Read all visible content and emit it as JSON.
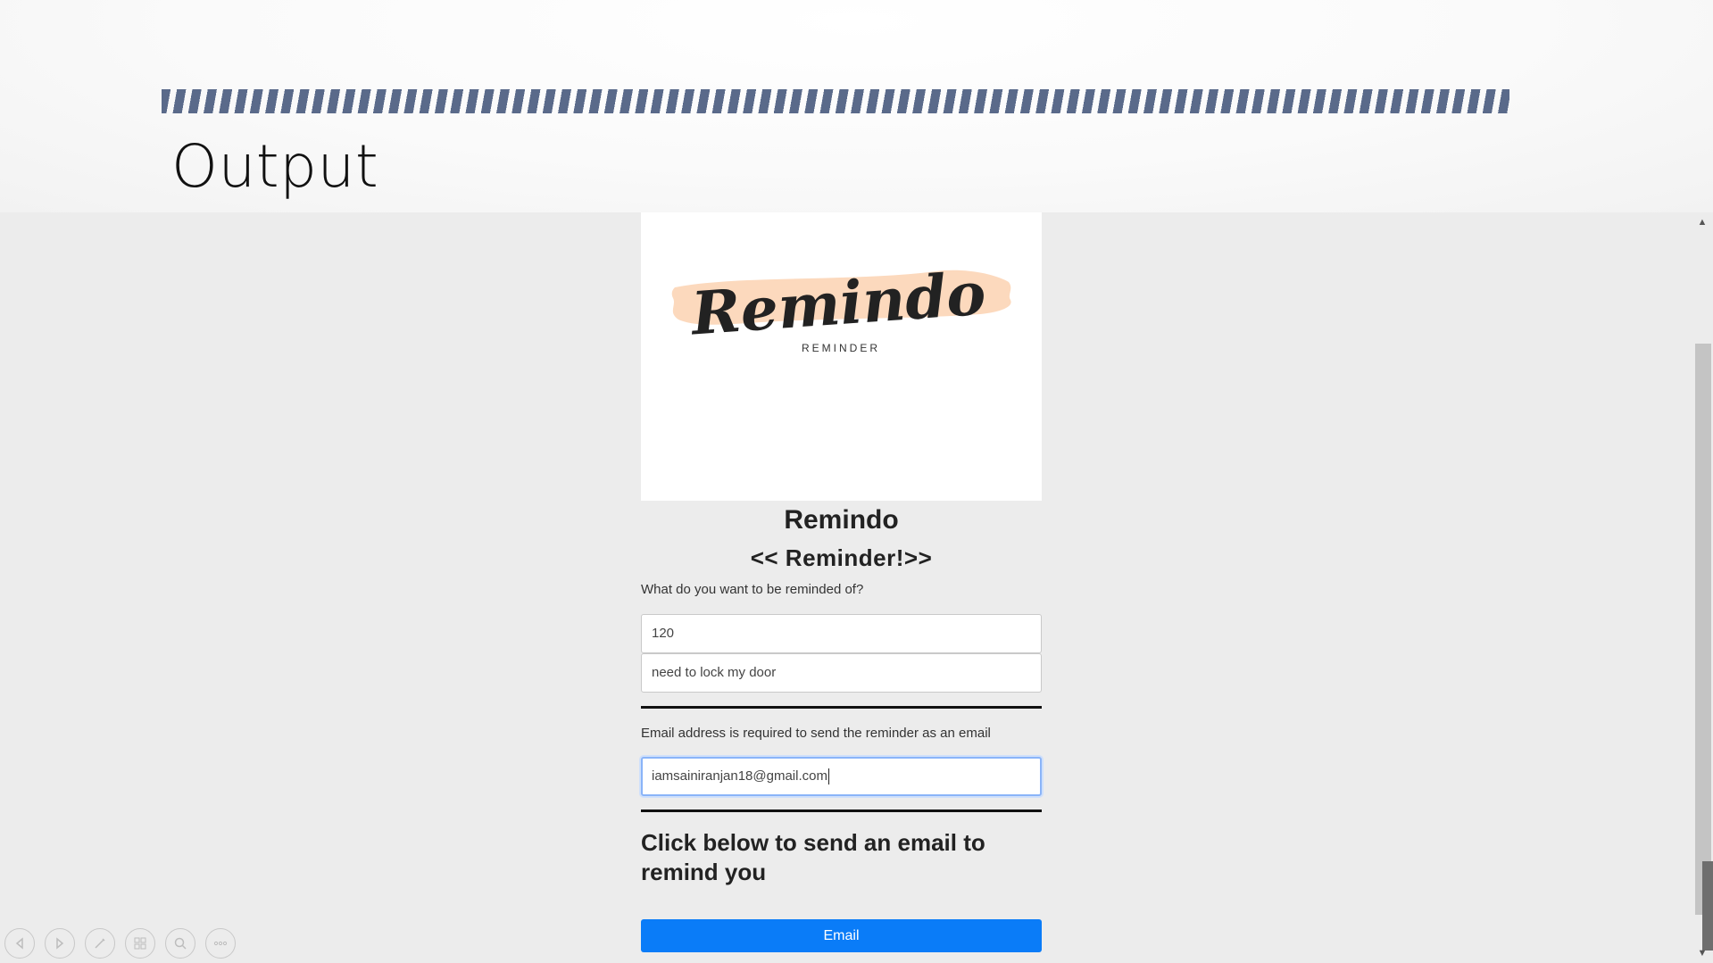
{
  "slide": {
    "title": "Output"
  },
  "app": {
    "logo": {
      "wordmark": "Remindo",
      "tagline": "REMINDER",
      "brush_color": "#fcd9bd"
    },
    "title": "Remindo",
    "subtitle": "<< Reminder!>>",
    "prompt_label": "What do you want to be reminded of?",
    "time_input": {
      "value": "120"
    },
    "message_input": {
      "value": "need to lock my door"
    },
    "email_label": "Email address is required to send the reminder as an email",
    "email_input": {
      "value": "iamsainiranjan18@gmail.com"
    },
    "cta_text": "Click below to send an email to remind you",
    "email_button": "Email",
    "accent_color": "#0a7cf8"
  },
  "toolbar": {
    "icons": [
      "previous-icon",
      "next-icon",
      "pen-icon",
      "slides-grid-icon",
      "zoom-icon",
      "more-icon"
    ]
  }
}
